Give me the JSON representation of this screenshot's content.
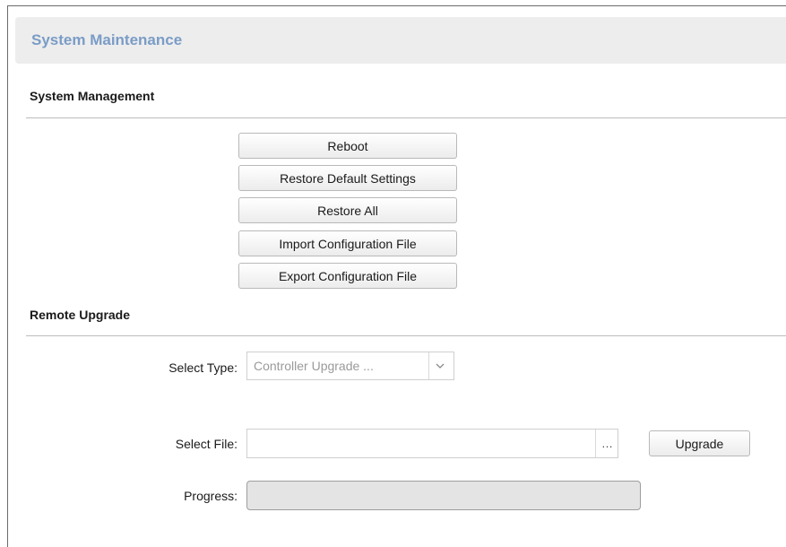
{
  "header": {
    "title": "System Maintenance"
  },
  "system_management": {
    "title": "System Management",
    "buttons": [
      {
        "label": "Reboot"
      },
      {
        "label": "Restore Default Settings"
      },
      {
        "label": "Restore All"
      },
      {
        "label": "Import Configuration File"
      },
      {
        "label": "Export Configuration File"
      }
    ]
  },
  "remote_upgrade": {
    "title": "Remote Upgrade",
    "select_type": {
      "label": "Select Type:",
      "value": "Controller Upgrade ...",
      "icon": "chevron-down-icon"
    },
    "select_file": {
      "label": "Select File:",
      "value": "",
      "browse_label": "…",
      "upgrade_label": "Upgrade"
    },
    "progress": {
      "label": "Progress:",
      "percent": 0
    }
  },
  "colors": {
    "accent": "#7a9cc6",
    "header_bg": "#ededed",
    "border": "#6b6b6b"
  }
}
